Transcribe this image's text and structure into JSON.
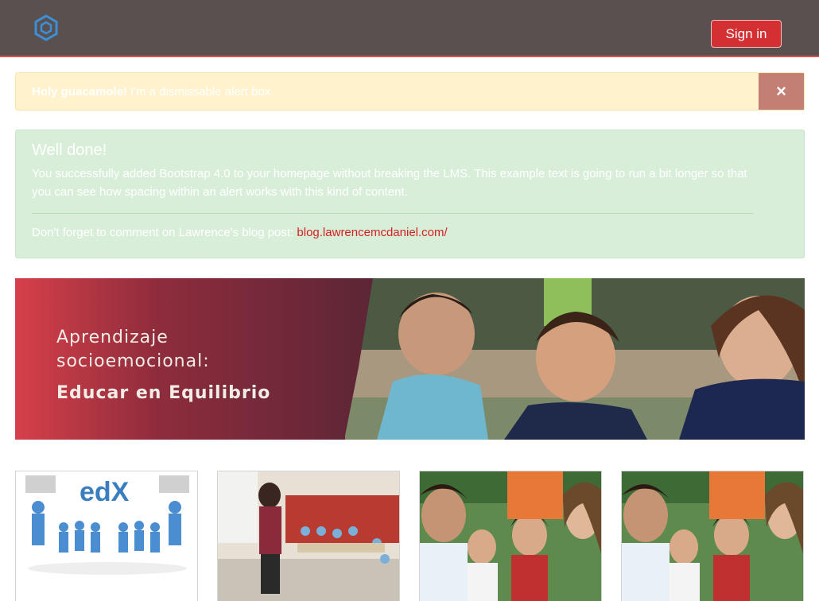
{
  "navbar": {
    "logo_icon": "hexagon-logo-icon",
    "signin_label": "Sign in",
    "accent_color": "#d42f33"
  },
  "alert_warning": {
    "strong": "Holy guacamole!",
    "text": "I'm a dismissable alert box.",
    "close_icon": "close-icon",
    "close_symbol": "×"
  },
  "alert_success": {
    "heading": "Well done!",
    "body": "You successfully added Bootstrap 4.0 to your homepage without breaking the LMS. This example text is going to run a bit longer so that you can see how spacing within an alert works with this kind of content.",
    "footer_text": "Don't forget to comment on Lawrence's blog post: ",
    "link_text": "blog.lawrencemcdaniel.com/"
  },
  "banner": {
    "line1": "Aprendizaje",
    "line2": "socioemocional:",
    "line3": "Educar en Equilibrio"
  },
  "cards": [
    {
      "image": "edx-puzzle-people-image",
      "logo_text": "edX"
    },
    {
      "image": "classroom-teacher-image"
    },
    {
      "image": "smiling-children-image"
    },
    {
      "image": "smiling-children-image"
    }
  ]
}
